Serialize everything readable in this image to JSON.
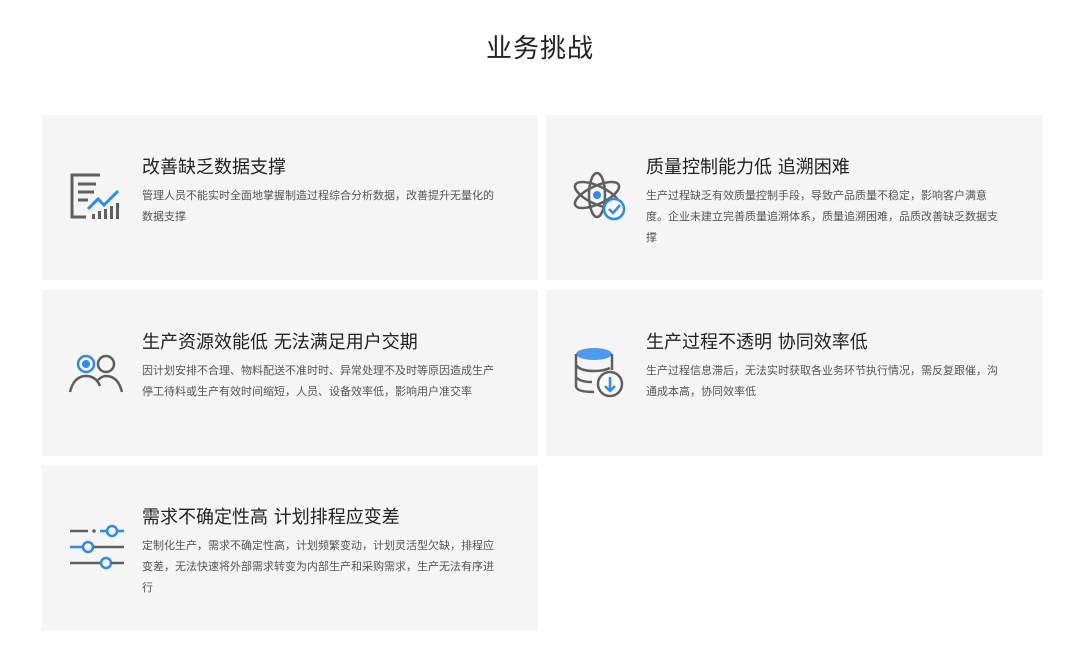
{
  "page": {
    "title": "业务挑战"
  },
  "colors": {
    "card_background": "#f5f5f5",
    "icon_gray": "#5f5f5f",
    "icon_accent": "#2e8bf0"
  },
  "cards": [
    {
      "icon": "data-report-icon",
      "title": "改善缺乏数据支撑",
      "description": "管理人员不能实时全面地掌握制造过程综合分析数据，改善提升无量化的数据支撑"
    },
    {
      "icon": "atom-check-icon",
      "title": "质量控制能力低 追溯困难",
      "description": "生产过程缺乏有效质量控制手段，导致产品质量不稳定，影响客户满意度。企业未建立完善质量追溯体系，质量追溯困难，品质改善缺乏数据支撑"
    },
    {
      "icon": "users-icon",
      "title": "生产资源效能低 无法满足用户交期",
      "description": "因计划安排不合理、物料配送不准时时、异常处理不及时等原因造成生产停工待料或生产有效时间缩短，人员、设备效率低，影响用户准交率"
    },
    {
      "icon": "database-download-icon",
      "title": "生产过程不透明 协同效率低",
      "description": "生产过程信息滞后，无法实时获取各业务环节执行情况，需反复跟催，沟通成本高，协同效率低"
    },
    {
      "icon": "sliders-icon",
      "title": "需求不确定性高 计划排程应变差",
      "description": "定制化生产，需求不确定性高，计划频繁变动，计划灵活型欠缺，排程应变差，无法快速将外部需求转变为内部生产和采购需求，生产无法有序进行"
    }
  ]
}
